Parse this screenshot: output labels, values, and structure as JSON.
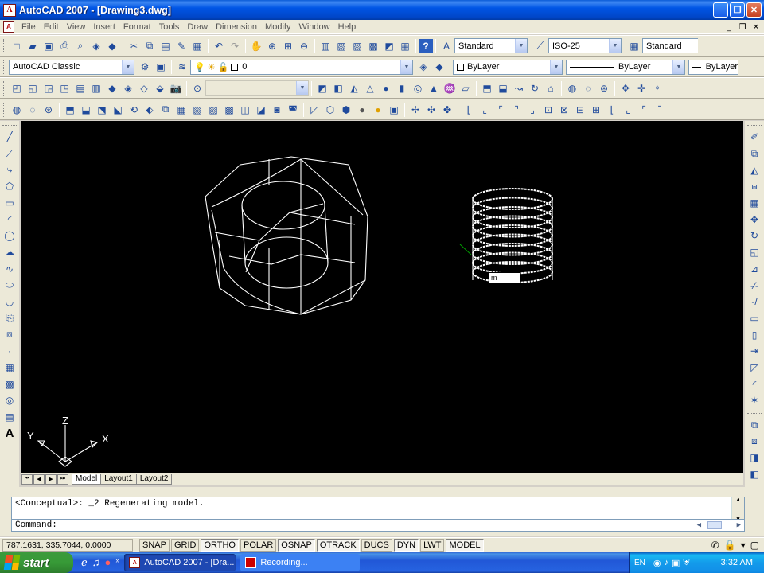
{
  "window": {
    "title": "AutoCAD 2007 - [Drawing3.dwg]",
    "controls": [
      "_",
      "❐",
      "✕"
    ]
  },
  "menu": {
    "items": [
      "File",
      "Edit",
      "View",
      "Insert",
      "Format",
      "Tools",
      "Draw",
      "Dimension",
      "Modify",
      "Window",
      "Help"
    ],
    "doc_controls": [
      "_",
      "❐",
      "✕"
    ]
  },
  "styles_toolbar": {
    "text_style": "Standard",
    "dim_style": "ISO-25",
    "table_style": "Standard"
  },
  "workspace_toolbar": {
    "workspace": "AutoCAD Classic",
    "layer": "0",
    "color": "ByLayer",
    "linetype": "ByLayer",
    "lineweight": "ByLayer"
  },
  "layout_tabs": {
    "tabs": [
      "Model",
      "Layout1",
      "Layout2"
    ],
    "active": "Model",
    "nav": [
      "⏮",
      "◀",
      "▶",
      "⏭"
    ]
  },
  "canvas": {
    "dyn_input": "m",
    "ucs_labels": {
      "x": "X",
      "y": "Y",
      "z": "Z"
    },
    "background": "#000000",
    "wire_color": "#ffffff"
  },
  "command": {
    "history": "<Conceptual>: _2 Regenerating model.",
    "prompt": "Command:"
  },
  "status": {
    "coords": "787.1631, 335.7044, 0.0000",
    "toggles": [
      {
        "label": "SNAP",
        "on": false
      },
      {
        "label": "GRID",
        "on": false
      },
      {
        "label": "ORTHO",
        "on": true
      },
      {
        "label": "POLAR",
        "on": false
      },
      {
        "label": "OSNAP",
        "on": true
      },
      {
        "label": "OTRACK",
        "on": true
      },
      {
        "label": "DUCS",
        "on": false
      },
      {
        "label": "DYN",
        "on": true
      },
      {
        "label": "LWT",
        "on": false
      },
      {
        "label": "MODEL",
        "on": true
      }
    ]
  },
  "taskbar": {
    "start_label": "start",
    "tasks": [
      {
        "label": "AutoCAD 2007 - [Dra...",
        "active": true
      },
      {
        "label": "Recording...",
        "active": false
      }
    ],
    "lang": "EN",
    "clock": "3:32 AM"
  }
}
